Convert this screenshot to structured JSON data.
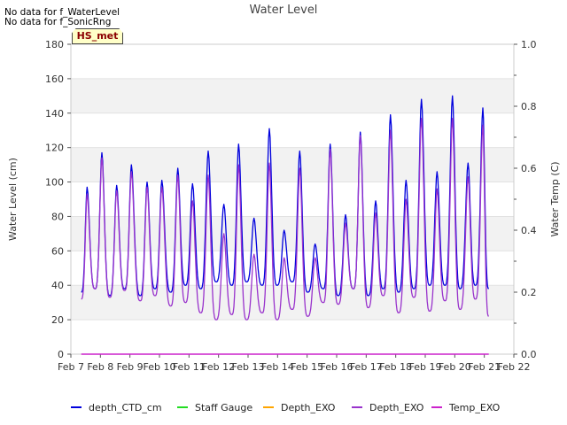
{
  "notes": [
    "No data for f_WaterLevel",
    "No data for f_SonicRng"
  ],
  "badge": "HS_met",
  "chart_data": {
    "type": "line",
    "title": "Water Level",
    "ylabel": "Water Level (cm)",
    "y2label": "Water Temp (C)",
    "ylim": [
      0,
      180
    ],
    "yticks": [
      0,
      20,
      40,
      60,
      80,
      100,
      120,
      140,
      160,
      180
    ],
    "y2lim": [
      0,
      1.0
    ],
    "y2ticks": [
      "0.0",
      "0.2",
      "0.4",
      "0.6",
      "0.8",
      "1.0"
    ],
    "xlim": [
      7,
      22
    ],
    "xticks": [
      {
        "v": 7,
        "label": "Feb 7"
      },
      {
        "v": 8,
        "label": "Feb 8"
      },
      {
        "v": 9,
        "label": "Feb 9"
      },
      {
        "v": 10,
        "label": "Feb 10"
      },
      {
        "v": 11,
        "label": "Feb 11"
      },
      {
        "v": 12,
        "label": "Feb 12"
      },
      {
        "v": 13,
        "label": "Feb 13"
      },
      {
        "v": 14,
        "label": "Feb 14"
      },
      {
        "v": 15,
        "label": "Feb 15"
      },
      {
        "v": 16,
        "label": "Feb 16"
      },
      {
        "v": 17,
        "label": "Feb 17"
      },
      {
        "v": 18,
        "label": "Feb 18"
      },
      {
        "v": 19,
        "label": "Feb 19"
      },
      {
        "v": 20,
        "label": "Feb 20"
      },
      {
        "v": 21,
        "label": "Feb 21"
      },
      {
        "v": 22,
        "label": "Feb 22"
      }
    ],
    "grid": "horizontal-bands",
    "legend_position": "bottom",
    "series": [
      {
        "name": "depth_CTD_cm",
        "color": "#0000dd",
        "axis": "left",
        "peaks": [
          {
            "t": 7.55,
            "v": 97
          },
          {
            "t": 8.05,
            "v": 117
          },
          {
            "t": 8.55,
            "v": 98
          },
          {
            "t": 9.05,
            "v": 110
          },
          {
            "t": 9.58,
            "v": 100
          },
          {
            "t": 10.08,
            "v": 101
          },
          {
            "t": 10.62,
            "v": 108
          },
          {
            "t": 11.12,
            "v": 99
          },
          {
            "t": 11.65,
            "v": 118
          },
          {
            "t": 12.18,
            "v": 87
          },
          {
            "t": 12.68,
            "v": 122
          },
          {
            "t": 13.2,
            "v": 79
          },
          {
            "t": 13.72,
            "v": 131
          },
          {
            "t": 14.22,
            "v": 72
          },
          {
            "t": 14.75,
            "v": 118
          },
          {
            "t": 15.27,
            "v": 64
          },
          {
            "t": 15.78,
            "v": 122
          },
          {
            "t": 16.3,
            "v": 81
          },
          {
            "t": 16.8,
            "v": 129
          },
          {
            "t": 17.32,
            "v": 89
          },
          {
            "t": 17.82,
            "v": 139
          },
          {
            "t": 18.35,
            "v": 101
          },
          {
            "t": 18.87,
            "v": 148
          },
          {
            "t": 19.4,
            "v": 106
          },
          {
            "t": 19.92,
            "v": 150
          },
          {
            "t": 20.45,
            "v": 111
          },
          {
            "t": 20.95,
            "v": 143
          }
        ],
        "troughs": [
          {
            "t": 7.35,
            "v": 36
          },
          {
            "t": 7.82,
            "v": 38
          },
          {
            "t": 8.32,
            "v": 34
          },
          {
            "t": 8.82,
            "v": 38
          },
          {
            "t": 9.35,
            "v": 34
          },
          {
            "t": 9.85,
            "v": 38
          },
          {
            "t": 10.38,
            "v": 36
          },
          {
            "t": 10.88,
            "v": 40
          },
          {
            "t": 11.4,
            "v": 38
          },
          {
            "t": 11.92,
            "v": 42
          },
          {
            "t": 12.45,
            "v": 40
          },
          {
            "t": 12.95,
            "v": 42
          },
          {
            "t": 13.48,
            "v": 40
          },
          {
            "t": 13.98,
            "v": 40
          },
          {
            "t": 14.5,
            "v": 42
          },
          {
            "t": 15.02,
            "v": 36
          },
          {
            "t": 15.55,
            "v": 38
          },
          {
            "t": 16.05,
            "v": 34
          },
          {
            "t": 16.57,
            "v": 38
          },
          {
            "t": 17.07,
            "v": 34
          },
          {
            "t": 17.58,
            "v": 38
          },
          {
            "t": 18.1,
            "v": 36
          },
          {
            "t": 18.62,
            "v": 38
          },
          {
            "t": 19.15,
            "v": 40
          },
          {
            "t": 19.67,
            "v": 40
          },
          {
            "t": 20.18,
            "v": 38
          },
          {
            "t": 20.7,
            "v": 40
          },
          {
            "t": 21.15,
            "v": 38
          }
        ]
      },
      {
        "name": "Staff Gauge",
        "color": "#22dd22",
        "axis": "left",
        "peaks": [],
        "troughs": []
      },
      {
        "name": "Depth_EXO",
        "color": "#ffa500",
        "axis": "left",
        "peaks": [],
        "troughs": []
      },
      {
        "name": "Depth_EXO",
        "color": "#9933cc",
        "axis": "left",
        "peaks": [
          {
            "t": 7.55,
            "v": 93
          },
          {
            "t": 8.05,
            "v": 114
          },
          {
            "t": 8.55,
            "v": 95
          },
          {
            "t": 9.05,
            "v": 106
          },
          {
            "t": 9.58,
            "v": 97
          },
          {
            "t": 10.08,
            "v": 97
          },
          {
            "t": 10.62,
            "v": 104
          },
          {
            "t": 11.12,
            "v": 89
          },
          {
            "t": 11.65,
            "v": 104
          },
          {
            "t": 12.18,
            "v": 70
          },
          {
            "t": 12.68,
            "v": 110
          },
          {
            "t": 13.2,
            "v": 58
          },
          {
            "t": 13.72,
            "v": 111
          },
          {
            "t": 14.22,
            "v": 56
          },
          {
            "t": 14.75,
            "v": 108
          },
          {
            "t": 15.27,
            "v": 56
          },
          {
            "t": 15.78,
            "v": 119
          },
          {
            "t": 16.3,
            "v": 76
          },
          {
            "t": 16.8,
            "v": 127
          },
          {
            "t": 17.32,
            "v": 82
          },
          {
            "t": 17.82,
            "v": 130
          },
          {
            "t": 18.35,
            "v": 90
          },
          {
            "t": 18.87,
            "v": 137
          },
          {
            "t": 19.4,
            "v": 96
          },
          {
            "t": 19.92,
            "v": 137
          },
          {
            "t": 20.45,
            "v": 103
          },
          {
            "t": 20.95,
            "v": 133
          }
        ],
        "troughs": [
          {
            "t": 7.35,
            "v": 32
          },
          {
            "t": 7.82,
            "v": 38
          },
          {
            "t": 8.32,
            "v": 33
          },
          {
            "t": 8.82,
            "v": 37
          },
          {
            "t": 9.35,
            "v": 31
          },
          {
            "t": 9.85,
            "v": 34
          },
          {
            "t": 10.38,
            "v": 28
          },
          {
            "t": 10.88,
            "v": 30
          },
          {
            "t": 11.4,
            "v": 24
          },
          {
            "t": 11.92,
            "v": 20
          },
          {
            "t": 12.45,
            "v": 23
          },
          {
            "t": 12.95,
            "v": 20
          },
          {
            "t": 13.48,
            "v": 24
          },
          {
            "t": 13.98,
            "v": 20
          },
          {
            "t": 14.5,
            "v": 26
          },
          {
            "t": 15.02,
            "v": 22
          },
          {
            "t": 15.55,
            "v": 30
          },
          {
            "t": 16.05,
            "v": 29
          },
          {
            "t": 16.57,
            "v": 38
          },
          {
            "t": 17.07,
            "v": 27
          },
          {
            "t": 17.58,
            "v": 34
          },
          {
            "t": 18.1,
            "v": 24
          },
          {
            "t": 18.62,
            "v": 33
          },
          {
            "t": 19.15,
            "v": 25
          },
          {
            "t": 19.67,
            "v": 31
          },
          {
            "t": 20.18,
            "v": 26
          },
          {
            "t": 20.7,
            "v": 32
          },
          {
            "t": 21.15,
            "v": 22
          }
        ]
      },
      {
        "name": "Temp_EXO",
        "color": "#cc22cc",
        "axis": "right",
        "line": [
          {
            "t": 7.35,
            "v": 0.0
          },
          {
            "t": 21.15,
            "v": 0.0
          }
        ]
      }
    ]
  }
}
